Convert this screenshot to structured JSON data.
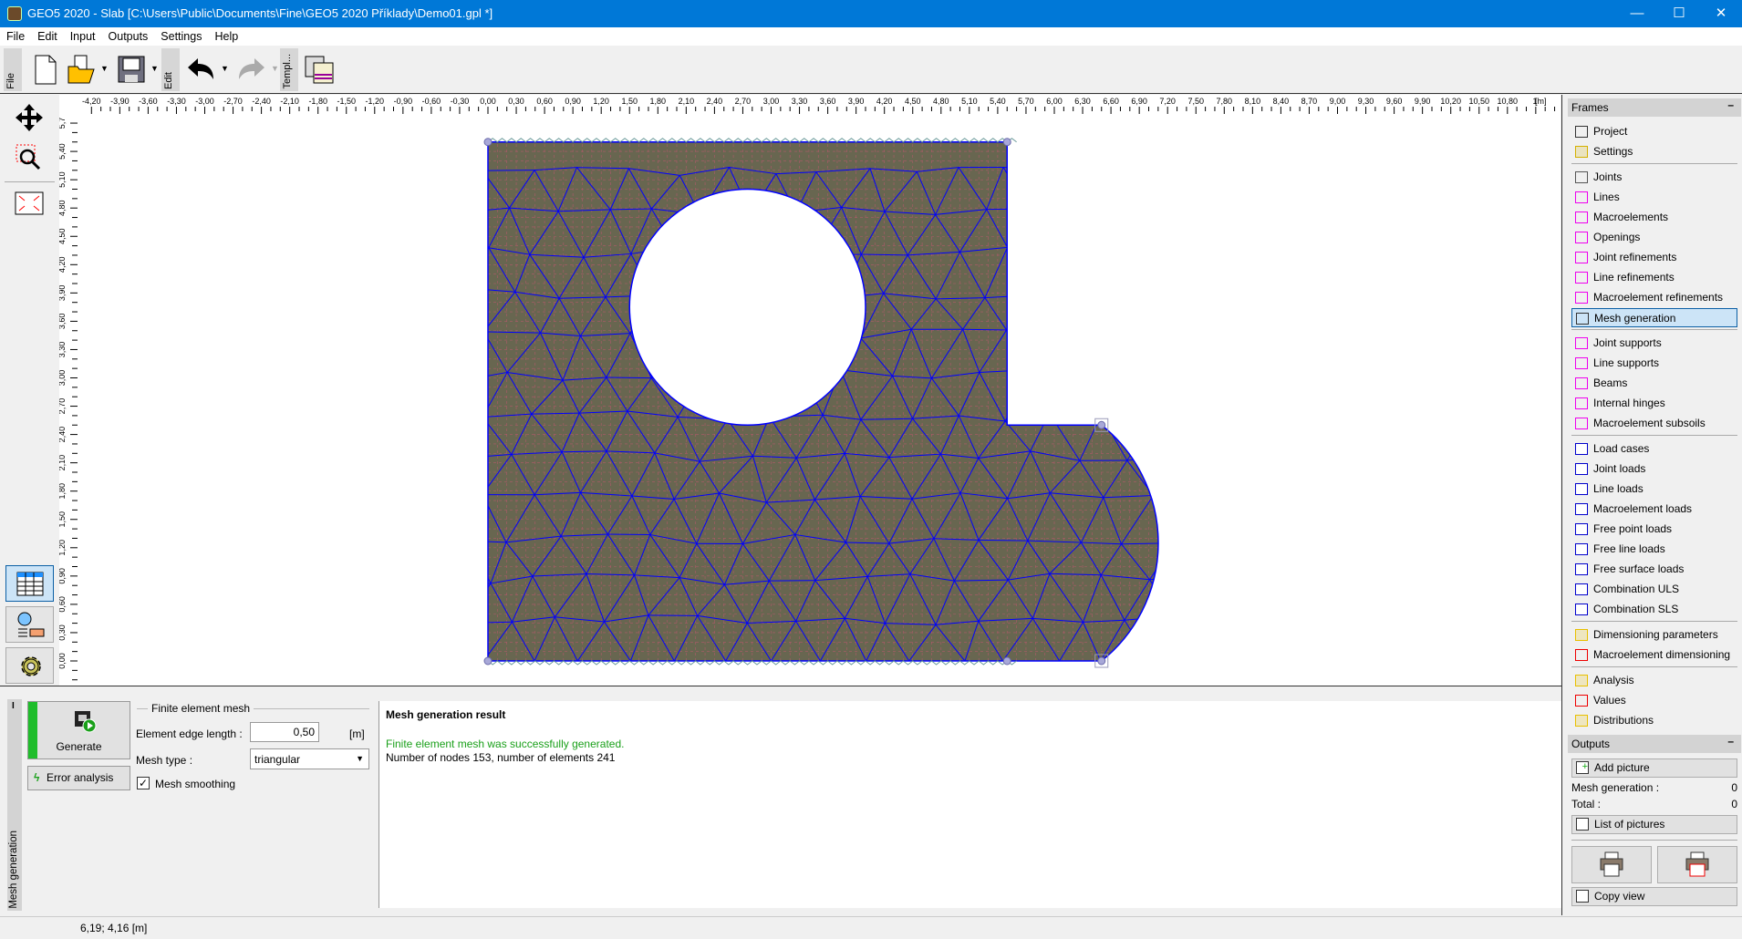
{
  "window": {
    "title": "GEO5 2020 - Slab [C:\\Users\\Public\\Documents\\Fine\\GEO5 2020 Příklady\\Demo01.gpl *]",
    "minimize": "—",
    "maximize": "☐",
    "close": "✕"
  },
  "menu": [
    "File",
    "Edit",
    "Input",
    "Outputs",
    "Settings",
    "Help"
  ],
  "toolbar": {
    "groups": [
      "File",
      "Edit",
      "Templ..."
    ],
    "buttons": [
      "new-file",
      "open-file",
      "save-file",
      "undo",
      "redo",
      "template"
    ]
  },
  "canvas": {
    "unit": "[m]",
    "x_labels": [
      "-4,20",
      "-3,90",
      "-3,60",
      "-3,30",
      "-3,00",
      "-2,70",
      "-2,40",
      "-2,10",
      "-1,80",
      "-1,50",
      "-1,20",
      "-0,90",
      "-0,60",
      "-0,30",
      "0,00",
      "0,30",
      "0,60",
      "0,90",
      "1,20",
      "1,50",
      "1,80",
      "2,10",
      "2,40",
      "2,70",
      "3,00",
      "3,30",
      "3,60",
      "3,90",
      "4,20",
      "4,50",
      "4,80",
      "5,10",
      "5,40",
      "5,70",
      "6,00",
      "6,30",
      "6,60",
      "6,90",
      "7,20",
      "7,50",
      "7,80",
      "8,10",
      "8,40",
      "8,70",
      "9,00",
      "9,30",
      "9,60",
      "9,90",
      "10,20",
      "10,50",
      "10,80",
      "1'"
    ],
    "y_labels": [
      "5,7",
      "5,40",
      "5,10",
      "4,80",
      "4,50",
      "4,20",
      "3,90",
      "3,60",
      "3,30",
      "3,00",
      "2,70",
      "2,40",
      "2,10",
      "1,80",
      "1,50",
      "1,20",
      "0,90",
      "0,60",
      "0,30",
      "0,00"
    ],
    "colors": {
      "fill": "#686650",
      "mesh": "#0000ff",
      "grid": "#b05a6a",
      "outline": "#6a4a8a"
    }
  },
  "bottom": {
    "tab_label": "Mesh generation",
    "generate_label": "Generate",
    "error_analysis_label": "Error analysis",
    "group_title": "Finite element mesh",
    "edge_length_label": "Element edge length :",
    "edge_length_value": "0,50",
    "edge_length_unit": "[m]",
    "mesh_type_label": "Mesh type :",
    "mesh_type_value": "triangular",
    "smoothing_label": "Mesh smoothing",
    "smoothing_checked": true,
    "result_title": "Mesh generation result",
    "result_success": "Finite element mesh was successfully generated.",
    "result_info": "Number of nodes 153, number of elements 241",
    "success_color": "#1aa01a"
  },
  "status": {
    "coords": "6,19; 4,16 [m]"
  },
  "frames": {
    "title": "Frames",
    "collapse": "–",
    "groups": [
      [
        {
          "label": "Project",
          "icon": "project-icon"
        },
        {
          "label": "Settings",
          "icon": "settings-icon"
        }
      ],
      [
        {
          "label": "Joints",
          "icon": "joints-icon"
        },
        {
          "label": "Lines",
          "icon": "lines-icon"
        },
        {
          "label": "Macroelements",
          "icon": "macroelements-icon"
        },
        {
          "label": "Openings",
          "icon": "openings-icon"
        },
        {
          "label": "Joint refinements",
          "icon": "joint-refinements-icon"
        },
        {
          "label": "Line refinements",
          "icon": "line-refinements-icon"
        },
        {
          "label": "Macroelement refinements",
          "icon": "macroelement-refinements-icon"
        },
        {
          "label": "Mesh generation",
          "icon": "mesh-generation-icon",
          "selected": true
        }
      ],
      [
        {
          "label": "Joint supports",
          "icon": "joint-supports-icon"
        },
        {
          "label": "Line supports",
          "icon": "line-supports-icon"
        },
        {
          "label": "Beams",
          "icon": "beams-icon"
        },
        {
          "label": "Internal hinges",
          "icon": "internal-hinges-icon"
        },
        {
          "label": "Macroelement subsoils",
          "icon": "macroelement-subsoils-icon"
        }
      ],
      [
        {
          "label": "Load cases",
          "icon": "load-cases-icon"
        },
        {
          "label": "Joint loads",
          "icon": "joint-loads-icon"
        },
        {
          "label": "Line loads",
          "icon": "line-loads-icon"
        },
        {
          "label": "Macroelement loads",
          "icon": "macroelement-loads-icon"
        },
        {
          "label": "Free point loads",
          "icon": "free-point-loads-icon"
        },
        {
          "label": "Free line loads",
          "icon": "free-line-loads-icon"
        },
        {
          "label": "Free surface loads",
          "icon": "free-surface-loads-icon"
        },
        {
          "label": "Combination ULS",
          "icon": "combination-uls-icon"
        },
        {
          "label": "Combination SLS",
          "icon": "combination-sls-icon"
        }
      ],
      [
        {
          "label": "Dimensioning parameters",
          "icon": "dimensioning-parameters-icon"
        },
        {
          "label": "Macroelement dimensioning",
          "icon": "macroelement-dimensioning-icon"
        }
      ],
      [
        {
          "label": "Analysis",
          "icon": "analysis-icon"
        },
        {
          "label": "Values",
          "icon": "values-icon"
        },
        {
          "label": "Distributions",
          "icon": "distributions-icon"
        }
      ]
    ]
  },
  "outputs": {
    "title": "Outputs",
    "collapse": "–",
    "add_picture": "Add picture",
    "mesh_generation_label": "Mesh generation :",
    "mesh_generation_count": "0",
    "total_label": "Total :",
    "total_count": "0",
    "list_of_pictures": "List of pictures",
    "copy_view": "Copy view"
  }
}
